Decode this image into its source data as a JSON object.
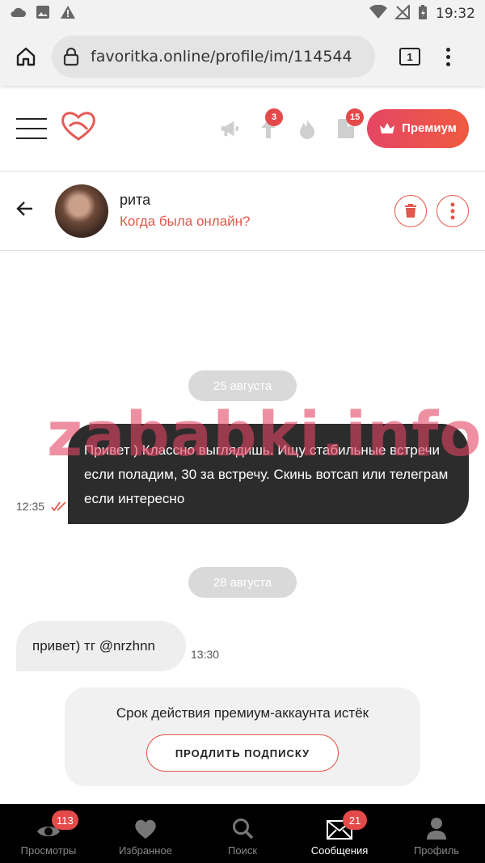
{
  "statusbar": {
    "time": "19:32"
  },
  "browser": {
    "url": "favoritka.online/profile/im/114544",
    "tab_count": "1"
  },
  "topnav": {
    "up_badge": "3",
    "book_badge": "15",
    "premium_label": "Премиум"
  },
  "chat": {
    "name": "рита",
    "status": "Когда была онлайн?"
  },
  "messages": {
    "date1": "25 августа",
    "out_text": "Привет ) Классно выглядишь. Ищу стабильные встречи если поладим, 30 за встречу. Скинь вотсап или телеграм если интересно",
    "out_time": "12:35",
    "date2": "28 августа",
    "in_text": "привет) тг @nrzhnn",
    "in_time": "13:30",
    "watermark": "zababki.info"
  },
  "notice": {
    "text": "Срок действия премиум-аккаунта истёк",
    "button": "ПРОДЛИТЬ ПОДПИСКУ"
  },
  "bottomnav": {
    "items": [
      {
        "label": "Просмотры",
        "badge": "113"
      },
      {
        "label": "Избранное"
      },
      {
        "label": "Поиск"
      },
      {
        "label": "Сообщения",
        "badge": "21"
      },
      {
        "label": "Профиль"
      }
    ]
  },
  "colors": {
    "accent": "#e2574c",
    "premium_gradient_start": "#e54665",
    "premium_gradient_end": "#f05a40"
  }
}
